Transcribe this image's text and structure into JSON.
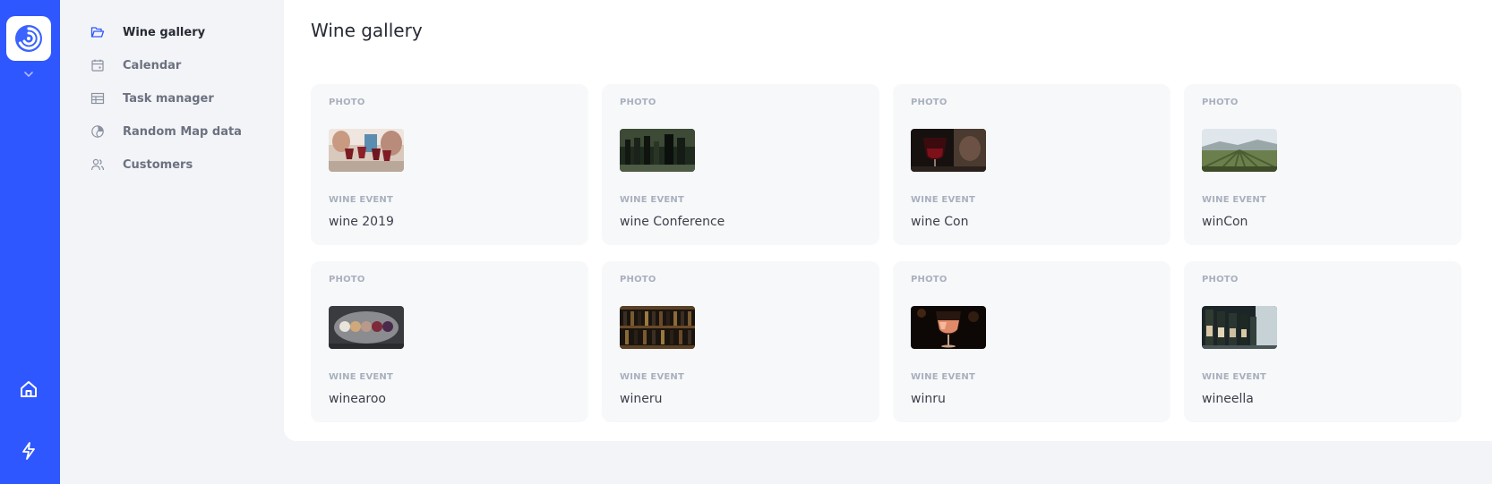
{
  "sidebar": {
    "items": [
      {
        "label": "Wine gallery",
        "icon": "folder-open-icon",
        "active": true
      },
      {
        "label": "Calendar",
        "icon": "calendar-icon",
        "active": false
      },
      {
        "label": "Task manager",
        "icon": "table-icon",
        "active": false
      },
      {
        "label": "Random Map data",
        "icon": "globe-icon",
        "active": false
      },
      {
        "label": "Customers",
        "icon": "users-icon",
        "active": false
      }
    ]
  },
  "rail": {
    "icons": [
      "app-logo-icon",
      "chevron-down-icon",
      "home-icon",
      "bolt-icon"
    ]
  },
  "main": {
    "title": "Wine gallery",
    "cards": [
      {
        "category": "PHOTO",
        "subcategory": "WINE EVENT",
        "name": "wine 2019",
        "image": "people-toasting-wine-photo"
      },
      {
        "category": "PHOTO",
        "subcategory": "WINE EVENT",
        "name": "wine Conference",
        "image": "wine-bottles-row-photo"
      },
      {
        "category": "PHOTO",
        "subcategory": "WINE EVENT",
        "name": "wine Con",
        "image": "red-wine-glass-photo"
      },
      {
        "category": "PHOTO",
        "subcategory": "WINE EVENT",
        "name": "winCon",
        "image": "vineyard-landscape-photo"
      },
      {
        "category": "PHOTO",
        "subcategory": "WINE EVENT",
        "name": "winearoo",
        "image": "wine-tasting-glasses-photo"
      },
      {
        "category": "PHOTO",
        "subcategory": "WINE EVENT",
        "name": "wineru",
        "image": "wine-cellar-shelves-photo"
      },
      {
        "category": "PHOTO",
        "subcategory": "WINE EVENT",
        "name": "winru",
        "image": "rose-wine-glass-photo"
      },
      {
        "category": "PHOTO",
        "subcategory": "WINE EVENT",
        "name": "wineella",
        "image": "wine-bottles-shelf-photo"
      }
    ]
  },
  "colors": {
    "rail": "#2f57ff",
    "accent": "#2f57ff",
    "card_bg": "#f7f8fa",
    "muted_label": "#a9b0bd"
  }
}
